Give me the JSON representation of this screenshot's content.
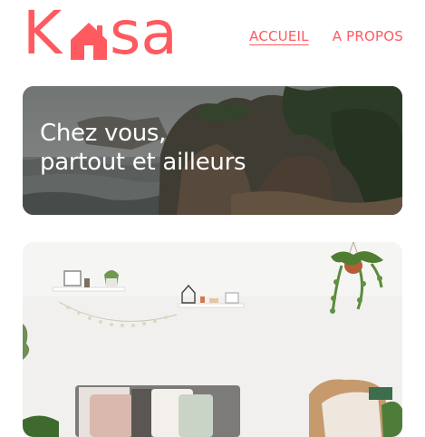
{
  "brand": {
    "logo_left": "K",
    "logo_right": "sa",
    "logo_text": "Kasa",
    "color": "#ff5a5f"
  },
  "nav": {
    "items": [
      {
        "label": "ACCUEIL",
        "active": true
      },
      {
        "label": "A PROPOS",
        "active": false
      }
    ]
  },
  "hero": {
    "title_line1": "Chez vous,",
    "title_line2": "partout et ailleurs"
  }
}
